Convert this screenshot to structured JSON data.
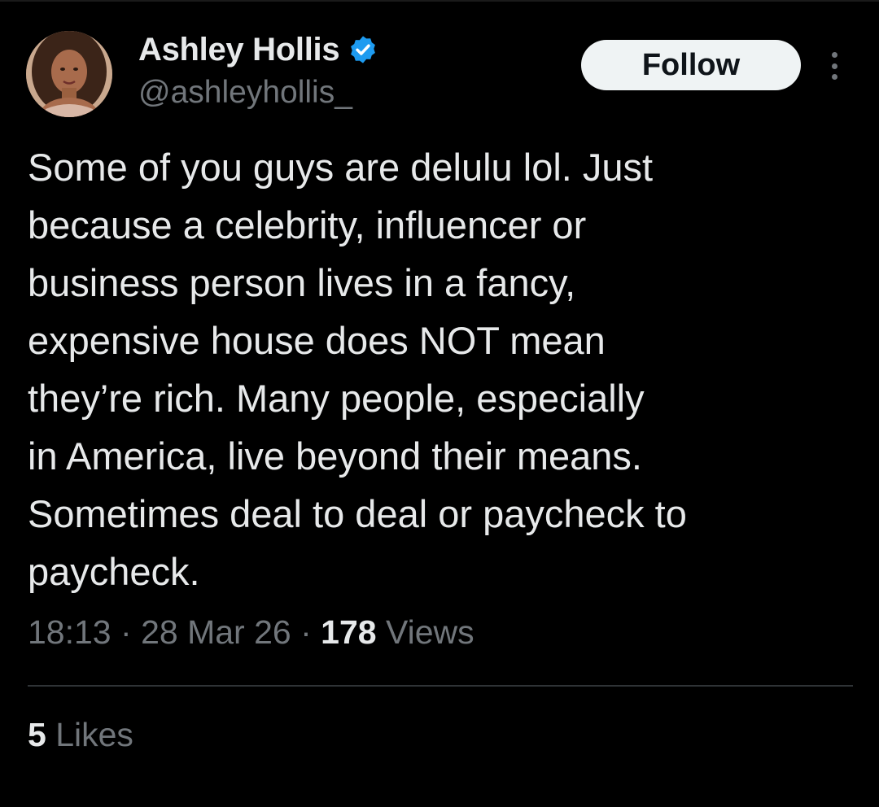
{
  "author": {
    "display_name": "Ashley Hollis",
    "handle": "@ashleyhollis_",
    "verified": true,
    "verified_badge_color": "#1d9bf0"
  },
  "actions": {
    "follow_label": "Follow",
    "more_icon": "more-vertical-icon"
  },
  "tweet": {
    "lines": [
      "Some of you guys are delulu lol. Just",
      "because a celebrity, influencer or",
      "business person lives in a fancy,",
      "expensive house does NOT mean",
      "they’re rich. Many people, especially",
      "in America, live beyond their means.",
      "Sometimes deal to deal or paycheck to",
      "paycheck."
    ],
    "time": "18:13",
    "separator": "·",
    "date": "28 Mar 26",
    "views_count": "178",
    "views_label": "Views"
  },
  "engagement": {
    "likes_count": "5",
    "likes_label": "Likes"
  },
  "colors": {
    "background": "#000000",
    "text_primary": "#e7e9ea",
    "text_secondary": "#71767b",
    "divider": "#2f3336",
    "follow_bg": "#eff3f4"
  }
}
